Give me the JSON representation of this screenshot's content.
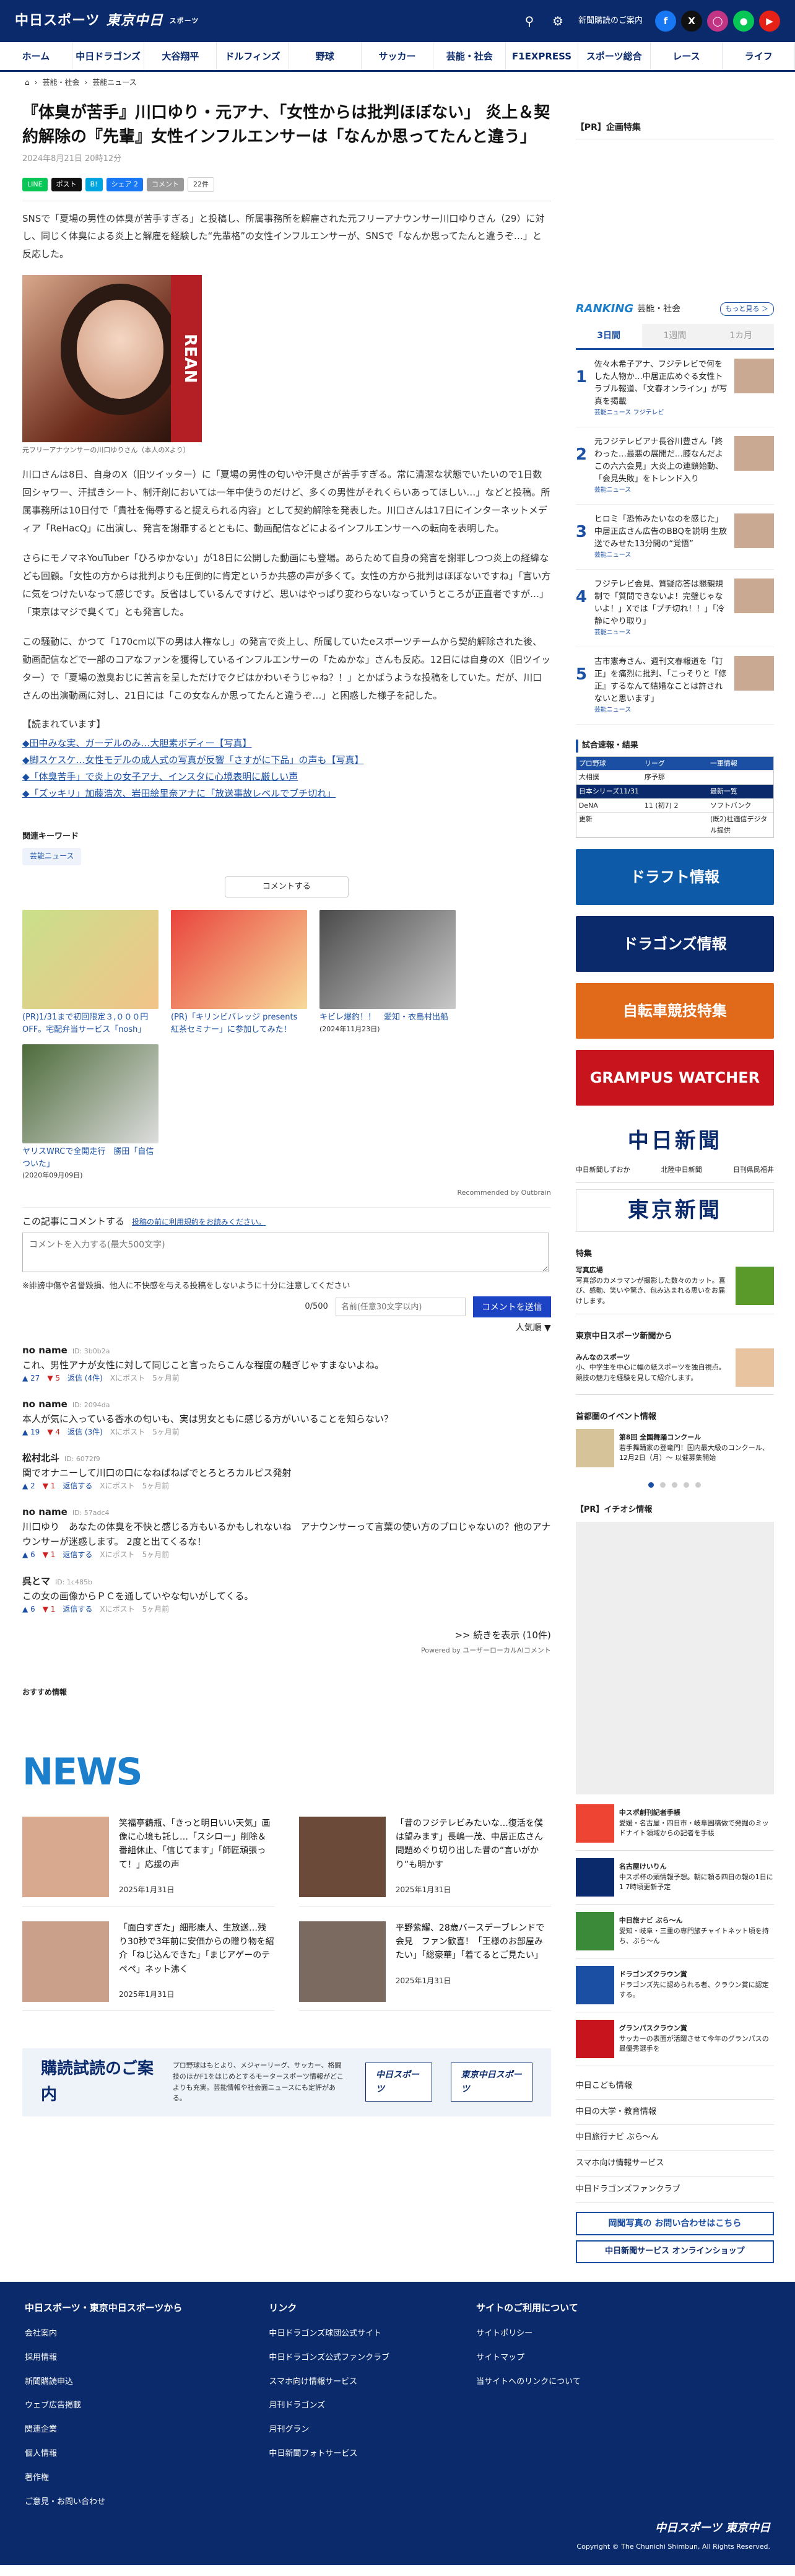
{
  "header": {
    "logo_a": "中日スポーツ",
    "logo_b": "東京中日",
    "logo_c": "スポーツ",
    "subscribe": "新聞購読のご案内"
  },
  "nav": [
    "ホーム",
    "中日ドラゴンズ",
    "大谷翔平",
    "ドルフィンズ",
    "野球",
    "サッカー",
    "芸能・社会",
    "F1EXPRESS",
    "スポーツ総合",
    "レース",
    "ライフ"
  ],
  "crumbs": [
    "芸能・社会",
    "芸能ニュース"
  ],
  "article": {
    "title": "『体臭が苦手』川口ゆり・元アナ、「女性からは批判ほぼない」 炎上＆契約解除の『先輩』女性インフルエンサーは「なんか思ってたんと違う」",
    "date": "2024年8月21日 20時12分",
    "share": {
      "line": "LINE",
      "x": "ポスト",
      "b": "B!",
      "fb": "シェア",
      "fb_count": "2",
      "c": "コメント",
      "c_count": "22件"
    },
    "lead": "SNSで「夏場の男性の体臭が苦手すぎる」と投稿し、所属事務所を解雇された元フリーアナウンサー川口ゆりさん（29）に対し、同じく体臭による炎上と解雇を経験した“先輩格”の女性インフルエンサーが、SNSで「なんか思ってたんと違うぞ…」と反応した。",
    "caption": "元フリーアナウンサーの川口ゆりさん（本人のXより）",
    "sign": "REAN",
    "p1": "川口さんは8日、自身のX（旧ツイッター）に「夏場の男性の匂いや汗臭さが苦手すぎる。常に清潔な状態でいたいので1日数回シャワー、汗拭きシート、制汗剤においては一年中使うのだけど、多くの男性がそれくらいあってほしい…」などと投稿。所属事務所は10日付で「貴社を侮辱すると捉えられる内容」として契約解除を発表した。川口さんは17日にインターネットメディア「ReHacQ」に出演し、発言を謝罪するとともに、動画配信などによるインフルエンサーへの転向を表明した。",
    "p2": "さらにモノマネYouTuber「ひろゆかない」が18日に公開した動画にも登場。あらためて自身の発言を謝罪しつつ炎上の経緯なども回顧。「女性の方からは批判よりも圧倒的に肯定というか共感の声が多くて。女性の方から批判はほぼないですね」「言い方に気をつけたいなって感じです。反省はしているんですけど、思いはやっぱり変わらないなっていうところが正直者ですが…」「東京はマジで臭くて」とも発言した。",
    "p3": "この騒動に、かつて「170cm以下の男は人権なし」の発言で炎上し、所属していたeスポーツチームから契約解除された後、動画配信などで一部のコアなファンを獲得しているインフルエンサーの「たぬかな」さんも反応。12日には自身のX（旧ツイッター）で「夏場の激臭おじに苦言を呈しただけでクビはかわいそうじゃね？！」とかばうような投稿をしていた。だが、川口さんの出演動画に対し、21日には「この女なんか思ってたんと違うぞ…」と困惑した様子を記した。"
  },
  "related": {
    "h": "【読まれています】",
    "items": [
      "◆田中みな実、ガーデルのみ…大胆素ボディー【写真】",
      "◆脚スケスケ…女性モデルの成人式の写真が反響「さすがに下品」の声も【写真】",
      "◆「体臭苦手」で炎上の女子アナ、インスタに心境表明に厳しい声",
      "◆「ズッキリ」加藤浩次、岩田絵里奈アナに「放送事故レベルでブチ切れ」"
    ]
  },
  "keywords": {
    "h": "関連キーワード",
    "items": [
      "芸能ニュース"
    ]
  },
  "comment_button": "コメントする",
  "cards": [
    {
      "title": "(PR)1/31まで初回限定３,０００円OFF。宅配弁当サービス「nosh」",
      "meta": ""
    },
    {
      "title": "(PR)「キリンビバレッジ presents 紅茶セミナー」に参加してみた！",
      "meta": ""
    },
    {
      "title": "キビレ爆釣！！　愛知・衣島村出船",
      "meta": "(2024年11月23日)"
    },
    {
      "title": "ヤリスWRCで全開走行　勝田「自信ついた」",
      "meta": "(2020年09月09日)"
    }
  ],
  "outbrain": "Recommended by Outbrain",
  "comments": {
    "h": "この記事にコメントする",
    "rule": "投稿の前に利用規約をお読みください。",
    "placeholder": "コメントを入力する(最大500文字)",
    "note": "※誹謗中傷や名誉毀損、他人に不快感を与える投稿をしないように十分に注意してください",
    "count": "0/500",
    "name_ph": "名前(任意30文字以内)",
    "submit": "コメントを送信",
    "sort": "人気順 ▼",
    "items": [
      {
        "name": "no name",
        "id": "ID: 3b0b2a",
        "text": "これ、男性アナが女性に対して同じこと言ったらこんな程度の騒ぎじゃすまないよね。",
        "up": "27",
        "down": "5",
        "reply": "返信 (4件)",
        "via": "Xにポスト",
        "ago": "5ヶ月前"
      },
      {
        "name": "no name",
        "id": "ID: 2094da",
        "text": "本人が気に入っている香水の匂いも、実は男女ともに感じる方がいいることを知らない？",
        "up": "19",
        "down": "4",
        "reply": "返信 (3件)",
        "via": "Xにポスト",
        "ago": "5ヶ月前"
      },
      {
        "name": "松村北斗",
        "id": "ID: 6072f9",
        "text": "関でオナニーして川口の口になねばねばでとろとろカルピス発射",
        "up": "2",
        "down": "1",
        "reply": "返信する",
        "via": "Xにポスト",
        "ago": "5ヶ月前"
      },
      {
        "name": "no name",
        "id": "ID: 57adc4",
        "text": "川口ゆり　あなたの体臭を不快と感じる方もいるかもしれないね　アナウンサーって言葉の使い方のプロじゃないの？他のアナウンサーが迷惑します。 2度と出てくるな！",
        "up": "6",
        "down": "1",
        "reply": "返信する",
        "via": "Xにポスト",
        "ago": "5ヶ月前"
      },
      {
        "name": "呉とマ",
        "id": "ID: 1c485b",
        "text": "この女の画像からＰＣを通していやな匂いがしてくる。",
        "up": "6",
        "down": "1",
        "reply": "返信する",
        "via": "Xにポスト",
        "ago": "5ヶ月前"
      }
    ],
    "more": ">> 続きを表示 (10件)",
    "powered": "Powered by ユーザーローカルAIコメント"
  },
  "osusume": "おすすめ情報",
  "news": {
    "logo": "NEWS",
    "items": [
      {
        "t": "笑福亭鶴瓶、「きっと明日いい天気」画像に心境も託し…「スシロー」削除＆番組休止、「信じてます」「師匠頑張って！」応援の声",
        "d": "2025年1月31日"
      },
      {
        "t": "「昔のフジテレビみたいな…復活を僕は望みます」長嶋一茂、中居正広さん問題めぐり切り出した昔の“言いがかり”も明かす",
        "d": "2025年1月31日"
      },
      {
        "t": "「面白すぎた」細形康人、生放送…残り30秒で3年前に安価からの贈り物を紹介「ねじ込んできた」「まじアゲーのテペペ」ネット沸く",
        "d": "2025年1月31日"
      },
      {
        "t": "平野紫耀、28歳バースデーブレンドで会見　ファン歓喜！「王様のお部屋みたい」「総豪華」「着てるとご見たい」",
        "d": "2025年1月31日"
      }
    ]
  },
  "trial": {
    "h": "購読試読のご案内",
    "p": "プロ野球はもとより、メジャーリーグ、サッカー、格闘技のほかF1をはじめとするモータースポーツ情報がどこよりも充実。芸能情報や社会面ニュースにも定評がある。",
    "l1": "中日スポーツ",
    "l2": "東京中日スポーツ"
  },
  "side": {
    "pr": "【PR】企画特集",
    "rank_a": "RANKING",
    "rank_b": "芸能・社会",
    "rank_more": "もっと見る ＞",
    "tabs": [
      "3日間",
      "1週間",
      "1カ月"
    ],
    "rank": [
      {
        "n": "1",
        "t": "佐々木希子アナ、フジテレビで何をした人物か…中居正広めぐる女性トラブル報道、「文春オンライン」が写真を掲載",
        "c": "芸能ニュース  フジテレビ"
      },
      {
        "n": "2",
        "t": "元フジテレビアナ長谷川豊さん「終わった…最悪の展開だ…膝なんだよこの六六会見」大炎上の連鎖始動、「会見失敗」をトレンド入り",
        "c": "芸能ニュース"
      },
      {
        "n": "3",
        "t": "ヒロミ「恐怖みたいなのを感じた」中居正広さん広告のBBQを説明 生放送でみせた13分間の“覚悟”",
        "c": "芸能ニュース"
      },
      {
        "n": "4",
        "t": "フジテレビ会見、質疑応答は懇親規制で「質問できないよ！完璧じゃないよ！」Xでは「プチ切れ！！」「冷静にやり取り」",
        "c": "芸能ニュース"
      },
      {
        "n": "5",
        "t": "古市憲寿さん、週刊文春報道を「訂正」を痛烈に批判、「こっそりと『修正』するなんて結婚なことは許されないと思います」",
        "c": "芸能ニュース"
      }
    ],
    "score_h": "試合速報・結果",
    "score_rows": [
      [
        "プロ野球",
        "リーグ",
        "一軍情報"
      ],
      [
        "大相撲",
        "序予那",
        ""
      ],
      [
        "日本シリーズ11/31",
        "",
        "最新一覧"
      ],
      [
        "DeNA",
        "11 (初7) 2",
        "ソフトバンク"
      ],
      [
        "更新",
        "",
        "(既2)社適信デジタル提供"
      ]
    ],
    "banners": [
      "ドラフト情報",
      "ドラゴンズ情報",
      "自転車競技特集",
      "GRAMPUS WATCHER"
    ],
    "paper": "中日新聞",
    "links": [
      "中日新聞しずおか",
      "北陸中日新聞",
      "日刊県民福井"
    ],
    "paper2": "東京新聞",
    "tokushu": "特集",
    "tok": {
      "h": "写真広場",
      "t": "写真部のカメラマンが撮影した数々のカット。喜び、感動、笑いや驚き、包み込まれる思いをお届けします。"
    },
    "guide_h": "東京中日スポーツ新聞から",
    "guide": {
      "h": "みんなのスポーツ",
      "t": "小、中学生を中心に幅の紙スポーツを独自視点。競技の魅力を経験を見して紹介します。"
    },
    "event_h": "首都圏のイベント情報",
    "event": {
      "h": "第8回 全国舞踊コンクール",
      "t": "若手舞踊家の登竜門！国内最大級のコンクール、12月2日（月）～ 以催募集開始"
    },
    "pr2": "【PR】イチオシ情報",
    "pr_items": [
      {
        "h": "中スポ創刊記者手帳",
        "t": "愛媛・名古屋・四日市・岐阜圏稿做で発掘のミッドナイト領域からの記者を手帳"
      },
      {
        "h": "名古屋けいりん",
        "t": "中スポ杯の頭情報予想。朝に頼る四日の報の1日に1 7時頃更新予定"
      },
      {
        "h": "中日旅ナビ ぶら～ん",
        "t": "愛知・岐阜・三重の専門旅チャイトネット頃を持ち、ぶら～ん"
      },
      {
        "h": "ドラゴンズクラウン賞",
        "t": "ドラゴンズ先に認められる者、クラウン賞に認定する。"
      },
      {
        "h": "グランパスクラウン賞",
        "t": "サッカーの表面が活躍させて今年のグランパスの最優秀選手を"
      }
    ],
    "list": [
      "中日こども情報",
      "中日の大学・教育情報",
      "中日旅行ナビ ぶら～ん",
      "スマホ向け情報サービス",
      "中日ドラゴンズファンクラブ"
    ],
    "b1": "岡聞写真の お問い合わせはこちら",
    "b2": "中日新聞サービス オンラインショップ"
  },
  "footer": {
    "c1h": "中日スポーツ・東京中日スポーツから",
    "c1": [
      "会社案内",
      "採用情報",
      "新聞購読申込",
      "ウェブ広告掲載",
      "関連企業",
      "個人情報",
      "著作権",
      "ご意見・お問い合わせ"
    ],
    "c2h": "リンク",
    "c2": [
      "中日ドラゴンズ球団公式サイト",
      "中日ドラゴンズ公式ファンクラブ",
      "スマホ向け情報サービス",
      "月刊ドラゴンズ",
      "月刊グラン",
      "中日新聞フォトサービス"
    ],
    "c3h": "サイトのご利用について",
    "c3": [
      "サイトポリシー",
      "サイトマップ",
      "当サイトへのリンクについて"
    ],
    "logo": "中日スポーツ 東京中日",
    "copy": "Copyright © The Chunichi Shimbun, All Rights Reserved."
  }
}
